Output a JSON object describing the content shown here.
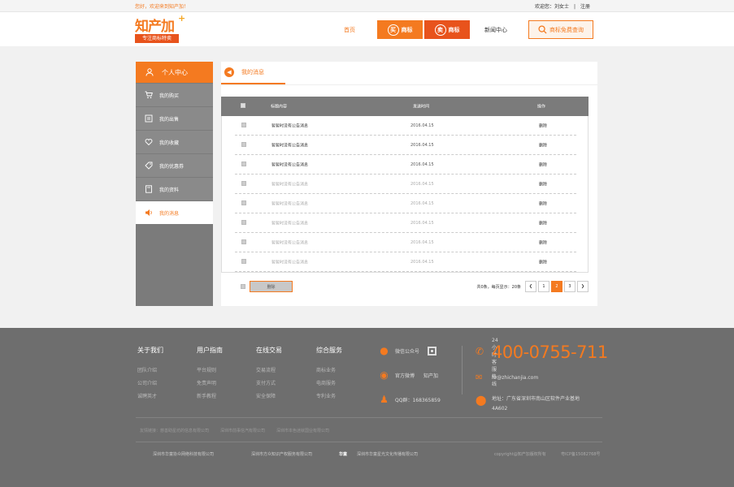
{
  "topbar": {
    "welcome": "您好，欢迎来到知产加！",
    "user_greeting": "欢迎您：刘女士",
    "separator": "|",
    "register": "注册"
  },
  "logo": {
    "name": "知产加",
    "plus": "+",
    "tagline": "专注商标特卖"
  },
  "nav": {
    "home": "首页",
    "buy_icon": "买",
    "buy": "商标",
    "sell_icon": "卖",
    "sell": "商标",
    "news": "新闻中心",
    "query": "商标免费查询"
  },
  "sidebar": {
    "header": "个人中心",
    "items": [
      {
        "label": "我的购买",
        "icon": "cart-icon"
      },
      {
        "label": "我的出售",
        "icon": "sell-icon"
      },
      {
        "label": "我的收藏",
        "icon": "heart-icon"
      },
      {
        "label": "我的优惠券",
        "icon": "coupon-icon"
      },
      {
        "label": "我的资料",
        "icon": "profile-icon"
      },
      {
        "label": "我的消息",
        "icon": "message-icon",
        "active": true
      }
    ]
  },
  "main": {
    "tab": "我的消息",
    "table": {
      "headers": {
        "title": "标题内容",
        "time": "发送时间",
        "action": "操作"
      },
      "rows": [
        {
          "title": "暂暂时没有公告消息",
          "time": "2016.04.15",
          "action": "删除",
          "read": false
        },
        {
          "title": "暂暂时没有公告消息",
          "time": "2016.04.15",
          "action": "删除",
          "read": false
        },
        {
          "title": "暂暂时没有公告消息",
          "time": "2016.04.15",
          "action": "删除",
          "read": false
        },
        {
          "title": "暂暂时没有公告消息",
          "time": "2016.04.15",
          "action": "删除",
          "read": true
        },
        {
          "title": "暂暂时没有公告消息",
          "time": "2016.04.15",
          "action": "删除",
          "read": true
        },
        {
          "title": "暂暂时没有公告消息",
          "time": "2016.04.15",
          "action": "删除",
          "read": true
        },
        {
          "title": "暂暂时没有公告消息",
          "time": "2016.04.15",
          "action": "删除",
          "read": true
        },
        {
          "title": "暂暂时没有公告消息",
          "time": "2016.04.15",
          "action": "删除",
          "read": true
        }
      ]
    },
    "delete_button": "删除",
    "pager": {
      "info": "共0条，每页显示：20条",
      "prev": "❮",
      "pages": [
        "1",
        "2",
        "3"
      ],
      "current_index": 1,
      "next": "❯"
    }
  },
  "footer": {
    "columns": [
      {
        "heading": "关于我们",
        "links": [
          "团队介绍",
          "公司介绍",
          "诚聘英才"
        ]
      },
      {
        "heading": "用户指南",
        "links": [
          "平台规则",
          "免责声明",
          "新手教程"
        ]
      },
      {
        "heading": "在线交易",
        "links": [
          "交易流程",
          "支付方式",
          "安全保障"
        ]
      },
      {
        "heading": "综合服务",
        "links": [
          "商标业务",
          "电商服务",
          "专利业务"
        ]
      }
    ],
    "social": {
      "wechat": "微信公众号",
      "weibo": "官方微博",
      "weibo_account": "知产加",
      "qq": "QQ群：168365859"
    },
    "hotline_label": "24小时客服热线",
    "hotline": "400-0755-711",
    "email": "hr@zhichanjia.com",
    "address": "地址：广东省深圳市南山区软件产业基地4A602",
    "friend_links": [
      "友情链接：慈善助星坊的信息有限公司",
      "深圳市前事信汽有限公司",
      "深圳市本色迷就国业有限公司"
    ],
    "partners": [
      "深圳市华童协众网络科技有限公司",
      "深圳市方众知识产权服务有限公司",
      "深圳市华童星光文化传播有限公司"
    ],
    "partner_logo": "华童",
    "copyright": "copyright@知产加版权所有",
    "icp": "粤ICP备15082768号"
  },
  "colors": {
    "brand_orange": "#f47a20",
    "dark_orange": "#e8531c",
    "sidebar_gray": "#7b7b7b",
    "footer_gray": "#6e6e6e"
  }
}
